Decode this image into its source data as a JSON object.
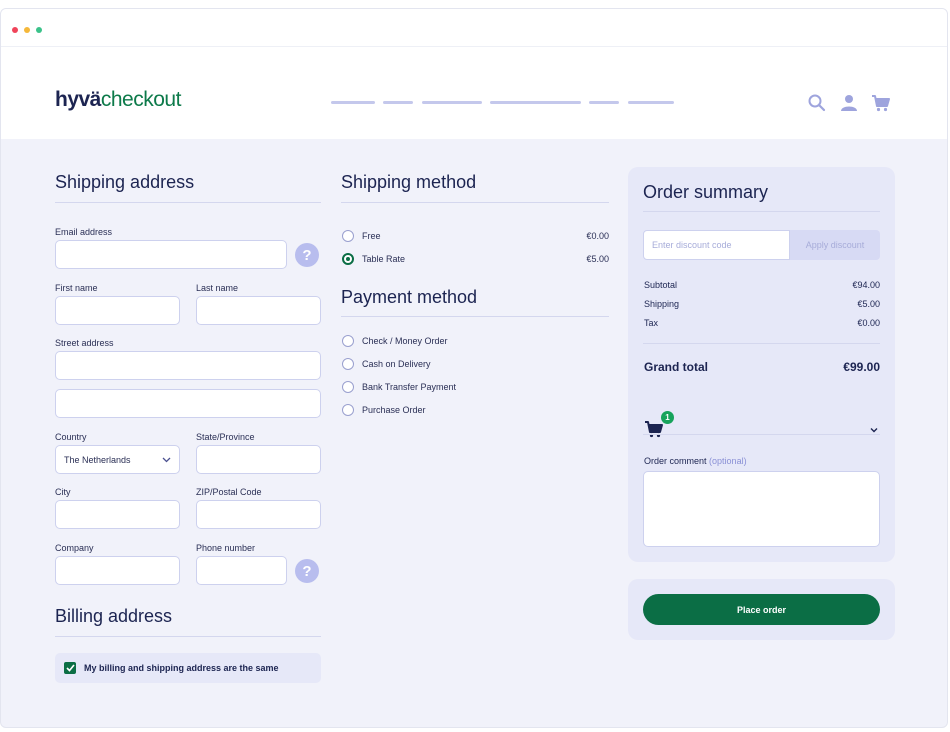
{
  "brand": {
    "name": "hyvä",
    "product": "checkout"
  },
  "header": {
    "icons": [
      "search-icon",
      "user-icon",
      "cart-icon"
    ]
  },
  "shipping_address": {
    "title": "Shipping address",
    "email_label": "Email address",
    "first_name_label": "First name",
    "last_name_label": "Last name",
    "street_label": "Street address",
    "country_label": "Country",
    "country_value": "The Netherlands",
    "state_label": "State/Province",
    "city_label": "City",
    "zip_label": "ZIP/Postal Code",
    "company_label": "Company",
    "phone_label": "Phone number",
    "help_glyph": "?"
  },
  "billing_address": {
    "title": "Billing address",
    "same_label": "My billing and shipping address are the same",
    "same_checked": true
  },
  "shipping_method": {
    "title": "Shipping method",
    "options": [
      {
        "label": "Free",
        "price": "€0.00",
        "selected": false
      },
      {
        "label": "Table Rate",
        "price": "€5.00",
        "selected": true
      }
    ]
  },
  "payment_method": {
    "title": "Payment method",
    "options": [
      {
        "label": "Check / Money Order"
      },
      {
        "label": "Cash on Delivery"
      },
      {
        "label": "Bank Transfer Payment"
      },
      {
        "label": "Purchase Order"
      }
    ]
  },
  "order_summary": {
    "title": "Order summary",
    "discount_placeholder": "Enter discount code",
    "apply_label": "Apply discount",
    "rows": [
      {
        "label": "Subtotal",
        "value": "€94.00"
      },
      {
        "label": "Shipping",
        "value": "€5.00"
      },
      {
        "label": "Tax",
        "value": "€0.00"
      }
    ],
    "grand_total_label": "Grand total",
    "grand_total_value": "€99.00",
    "cart_count": "1",
    "comment_label": "Order comment",
    "comment_optional": "(optional)"
  },
  "place_order_label": "Place order",
  "colors": {
    "brand_green": "#0b6e45",
    "navy": "#1c2451",
    "lavender": "#e6e8f8",
    "page_bg": "#f1f2fa"
  }
}
